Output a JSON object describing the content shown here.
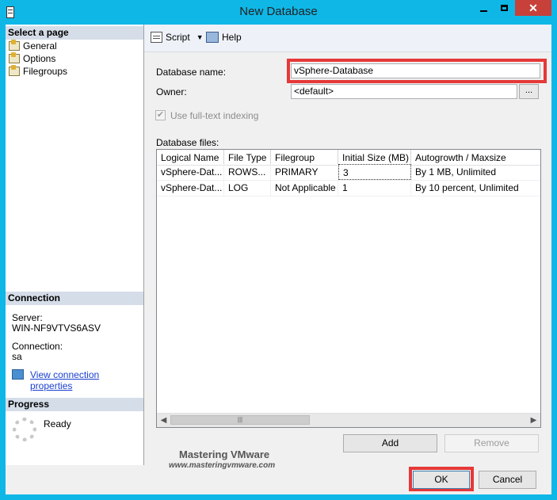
{
  "window": {
    "title": "New Database"
  },
  "left_pane": {
    "select_page_header": "Select a page",
    "pages": [
      {
        "label": "General"
      },
      {
        "label": "Options"
      },
      {
        "label": "Filegroups"
      }
    ],
    "connection_header": "Connection",
    "server_label": "Server:",
    "server_value": "WIN-NF9VTVS6ASV",
    "connection_label": "Connection:",
    "connection_value": "sa",
    "view_connection_link": "View connection properties",
    "progress_header": "Progress",
    "progress_status": "Ready"
  },
  "toolbar": {
    "script_label": "Script",
    "help_label": "Help"
  },
  "form": {
    "database_name_label": "Database name:",
    "database_name_value": "vSphere-Database",
    "owner_label": "Owner:",
    "owner_value": "<default>",
    "browse_label": "...",
    "fulltext_label": "Use full-text indexing",
    "fulltext_checked": true,
    "database_files_label": "Database files:"
  },
  "files_table": {
    "columns": [
      "Logical Name",
      "File Type",
      "Filegroup",
      "Initial Size (MB)",
      "Autogrowth / Maxsize"
    ],
    "rows": [
      [
        "vSphere-Dat...",
        "ROWS...",
        "PRIMARY",
        "3",
        "By 1 MB, Unlimited"
      ],
      [
        "vSphere-Dat...",
        "LOG",
        "Not Applicable",
        "1",
        "By 10 percent, Unlimited"
      ]
    ]
  },
  "buttons": {
    "add": "Add",
    "remove": "Remove",
    "ok": "OK",
    "cancel": "Cancel"
  },
  "watermark": {
    "line1": "Mastering VMware",
    "line2": "www.masteringvmware.com"
  },
  "colors": {
    "title_bar": "#0fb7e7",
    "close_button": "#c7403a",
    "highlight_box": "#e63838",
    "link": "#1a3fcf"
  }
}
